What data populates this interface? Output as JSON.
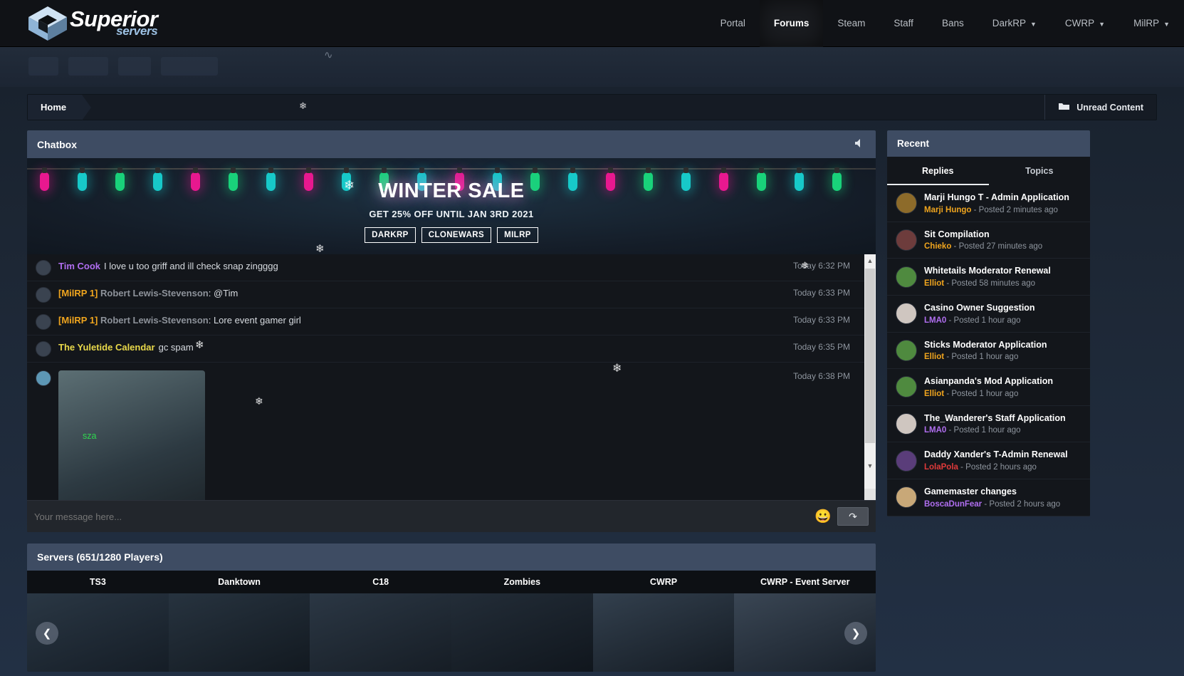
{
  "site": {
    "logo_primary": "Superior",
    "logo_secondary": "servers"
  },
  "nav": {
    "items": [
      {
        "label": "Portal",
        "active": false,
        "dropdown": false
      },
      {
        "label": "Forums",
        "active": true,
        "dropdown": false
      },
      {
        "label": "Steam",
        "active": false,
        "dropdown": false
      },
      {
        "label": "Staff",
        "active": false,
        "dropdown": false
      },
      {
        "label": "Bans",
        "active": false,
        "dropdown": false
      },
      {
        "label": "DarkRP",
        "active": false,
        "dropdown": true
      },
      {
        "label": "CWRP",
        "active": false,
        "dropdown": true
      },
      {
        "label": "MilRP",
        "active": false,
        "dropdown": true
      }
    ]
  },
  "breadcrumb": {
    "home": "Home",
    "unread": "Unread Content"
  },
  "chatbox": {
    "title": "Chatbox",
    "mute_icon": "speaker-icon",
    "banner": {
      "title": "WINTER SALE",
      "subtitle": "GET 25% OFF UNTIL JAN 3RD 2021",
      "buttons": [
        "DARKRP",
        "CLONEWARS",
        "MILRP"
      ]
    },
    "messages": [
      {
        "user": "Tim Cook",
        "user_color": "#b06ef0",
        "tag": "",
        "text": "I love u too griff and ill check snap zingggg",
        "time": "Today 6:32 PM",
        "type": "text"
      },
      {
        "user": "Robert Lewis-Stevenson",
        "user_color": "#8d929a",
        "tag": "[MilRP 1]",
        "text": ": @Tim",
        "time": "Today 6:33 PM",
        "type": "text"
      },
      {
        "user": "Robert Lewis-Stevenson",
        "user_color": "#8d929a",
        "tag": "[MilRP 1]",
        "text": ": Lore event gamer girl",
        "time": "Today 6:33 PM",
        "type": "text"
      },
      {
        "user": "The Yuletide Calendar",
        "user_color": "#e8d84a",
        "tag": "",
        "text": "gc spam",
        "time": "Today 6:35 PM",
        "type": "text"
      },
      {
        "user": "sza",
        "user_color": "#2fd84f",
        "tag": "",
        "text": "",
        "time": "Today 6:38 PM",
        "type": "image"
      }
    ],
    "input_placeholder": "Your message here...",
    "emoji_icon": "smiley-icon",
    "send_icon": "send-icon"
  },
  "servers": {
    "title": "Servers (651/1280 Players)",
    "tabs": [
      "TS3",
      "Danktown",
      "C18",
      "Zombies",
      "CWRP",
      "CWRP - Event Server"
    ],
    "prev_icon": "chevron-left-icon",
    "next_icon": "chevron-right-icon"
  },
  "recent": {
    "title": "Recent",
    "tabs": [
      {
        "label": "Replies",
        "active": true
      },
      {
        "label": "Topics",
        "active": false
      }
    ],
    "items": [
      {
        "title": "Marji Hungo T - Admin Application",
        "author": "Marji Hungo",
        "author_color": "#f0a51e",
        "meta": "- Posted 2 minutes ago",
        "avatar": "#8d6b2a"
      },
      {
        "title": "Sit Compilation",
        "author": "Chieko",
        "author_color": "#f0a51e",
        "meta": "- Posted 27 minutes ago",
        "avatar": "#6d3c3c"
      },
      {
        "title": "Whitetails Moderator Renewal",
        "author": "Elliot",
        "author_color": "#f0a51e",
        "meta": "- Posted 58 minutes ago",
        "avatar": "#4f8a3f"
      },
      {
        "title": "Casino Owner Suggestion",
        "author": "LMA0",
        "author_color": "#b06ef0",
        "meta": "- Posted 1 hour ago",
        "avatar": "#cfc6c0"
      },
      {
        "title": "Sticks Moderator Application",
        "author": "Elliot",
        "author_color": "#f0a51e",
        "meta": "- Posted 1 hour ago",
        "avatar": "#4f8a3f"
      },
      {
        "title": "Asianpanda's Mod Application",
        "author": "Elliot",
        "author_color": "#f0a51e",
        "meta": "- Posted 1 hour ago",
        "avatar": "#4f8a3f"
      },
      {
        "title": "The_Wanderer's Staff Application",
        "author": "LMA0",
        "author_color": "#b06ef0",
        "meta": "- Posted 1 hour ago",
        "avatar": "#cfc6c0"
      },
      {
        "title": "Daddy Xander's T-Admin Renewal",
        "author": "LolaPola",
        "author_color": "#e03a3a",
        "meta": "- Posted 2 hours ago",
        "avatar": "#5a3d7a"
      },
      {
        "title": "Gamemaster changes",
        "author": "BoscaDunFear",
        "author_color": "#b06ef0",
        "meta": "- Posted 2 hours ago",
        "avatar": "#c8a878"
      }
    ]
  },
  "theme": {
    "accent": "#3e4c63",
    "panel_bg": "#13161b",
    "page_bg": "#1d2735"
  }
}
